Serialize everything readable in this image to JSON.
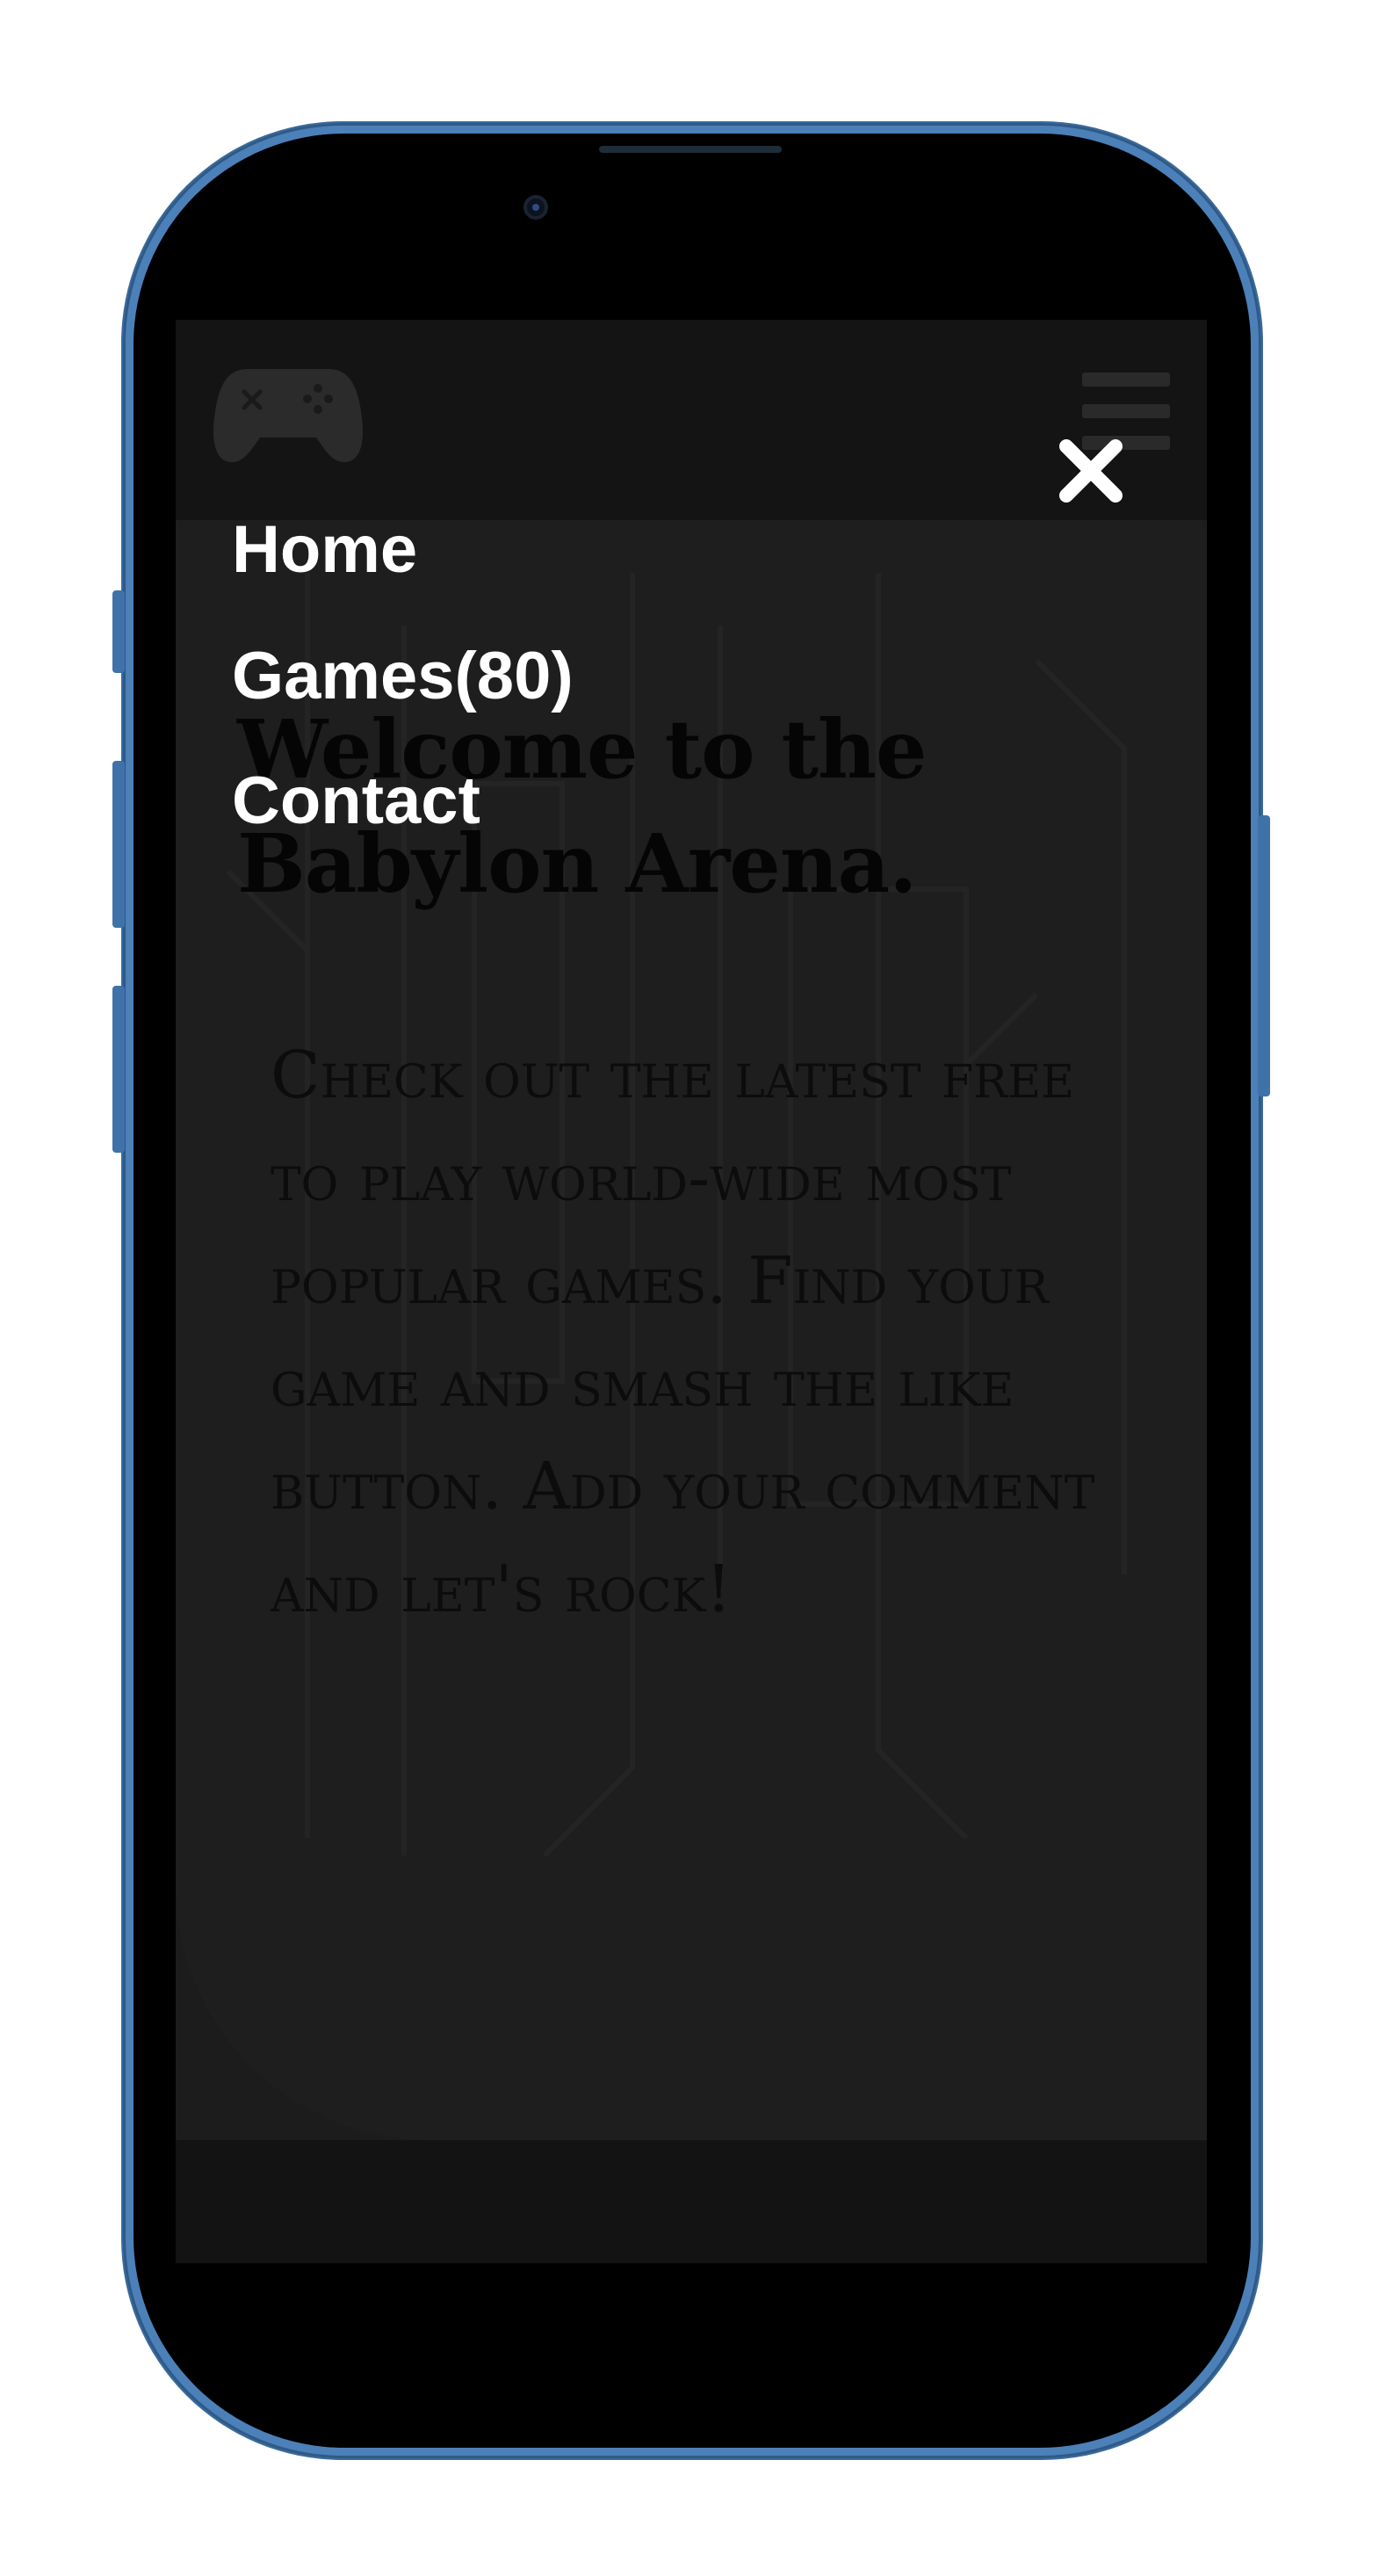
{
  "device": {
    "frame_color": "#4c80b8"
  },
  "header": {
    "logo_icon": "gamepad-icon",
    "menu_icon": "hamburger-icon"
  },
  "menu": {
    "close_icon": "close-icon",
    "items": [
      {
        "label": "Home"
      },
      {
        "label": "Games(80)"
      },
      {
        "label": "Contact"
      }
    ]
  },
  "hero": {
    "title": "Welcome to the Babylon Arena.",
    "text": "Check out the latest free to play world-wide most popular games. Find your game and smash the like button. Add your comment and let's rock!"
  },
  "colors": {
    "overlay": "#1a1a1a",
    "menu_text": "#ffffff"
  }
}
